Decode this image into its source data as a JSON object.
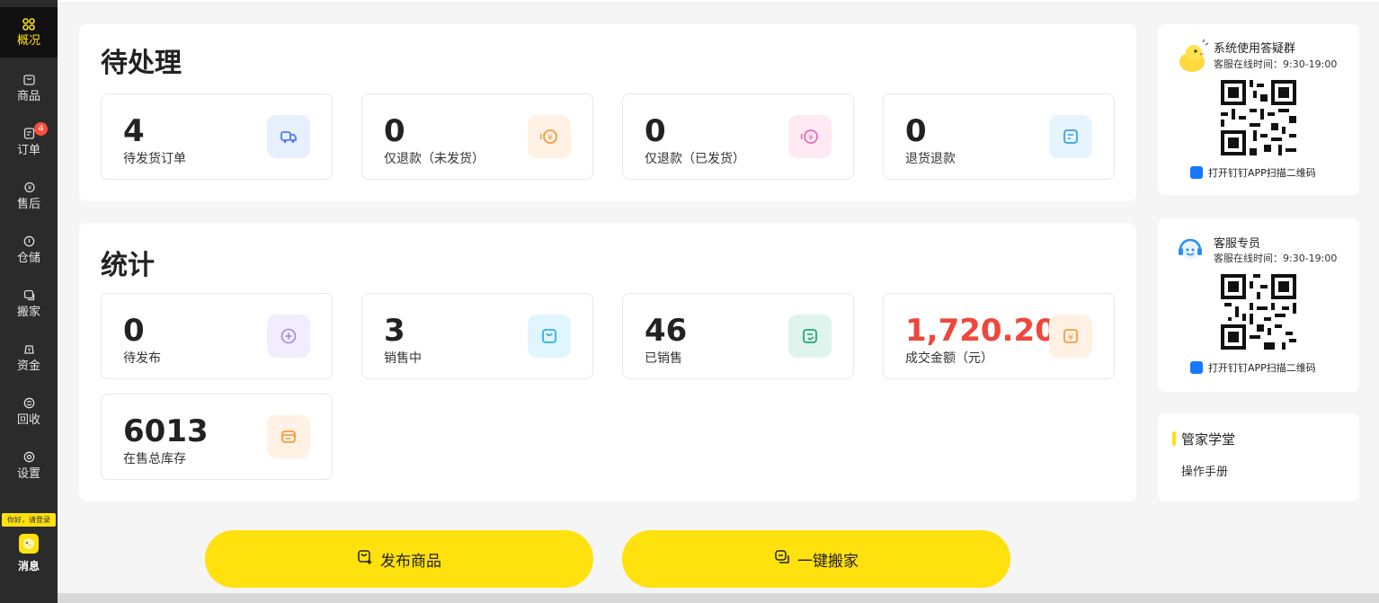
{
  "sidebar": {
    "items": [
      {
        "label": "概况",
        "icon": "dashboard-icon"
      },
      {
        "label": "商品",
        "icon": "bag-icon"
      },
      {
        "label": "订单",
        "icon": "order-icon",
        "badge": "4"
      },
      {
        "label": "售后",
        "icon": "refund-icon"
      },
      {
        "label": "仓储",
        "icon": "warehouse-icon"
      },
      {
        "label": "搬家",
        "icon": "move-icon"
      },
      {
        "label": "资金",
        "icon": "money-icon"
      },
      {
        "label": "回收",
        "icon": "recycle-icon"
      },
      {
        "label": "设置",
        "icon": "settings-icon"
      }
    ],
    "login_tag": "你好，请登录",
    "message_label": "消息"
  },
  "pending": {
    "title": "待处理",
    "cards": [
      {
        "value": "4",
        "label": "待发货订单",
        "icon": "truck-icon"
      },
      {
        "value": "0",
        "label": "仅退款（未发货）",
        "icon": "refund-coin-icon"
      },
      {
        "value": "0",
        "label": "仅退款（已发货）",
        "icon": "refund-coin-icon"
      },
      {
        "value": "0",
        "label": "退货退款",
        "icon": "return-doc-icon"
      }
    ]
  },
  "stats": {
    "title": "统计",
    "cards": [
      {
        "value": "0",
        "label": "待发布",
        "icon": "plus-circle-icon"
      },
      {
        "value": "3",
        "label": "销售中",
        "icon": "bag-icon"
      },
      {
        "value": "46",
        "label": "已销售",
        "icon": "sold-doc-icon"
      },
      {
        "value": "1,720.20",
        "label": "成交金额（元）",
        "icon": "yuan-icon"
      },
      {
        "value": "6013",
        "label": "在售总库存",
        "icon": "inventory-icon"
      }
    ]
  },
  "support_group": {
    "title": "系统使用答疑群",
    "hours": "客服在线时间：9:30-19:00",
    "link": "打开钉钉APP扫描二维码"
  },
  "support_agent": {
    "title": "客服专员",
    "hours": "客服在线时间：9:30-19:00",
    "link": "打开钉钉APP扫描二维码"
  },
  "academy": {
    "title": "管家学堂",
    "item": "操作手册"
  },
  "actions": {
    "publish": "发布商品",
    "move": "一键搬家"
  },
  "colors": {
    "accent": "#ffe10d",
    "sidebar_bg": "#2b2b2b",
    "amount_red": "#f0463c"
  }
}
